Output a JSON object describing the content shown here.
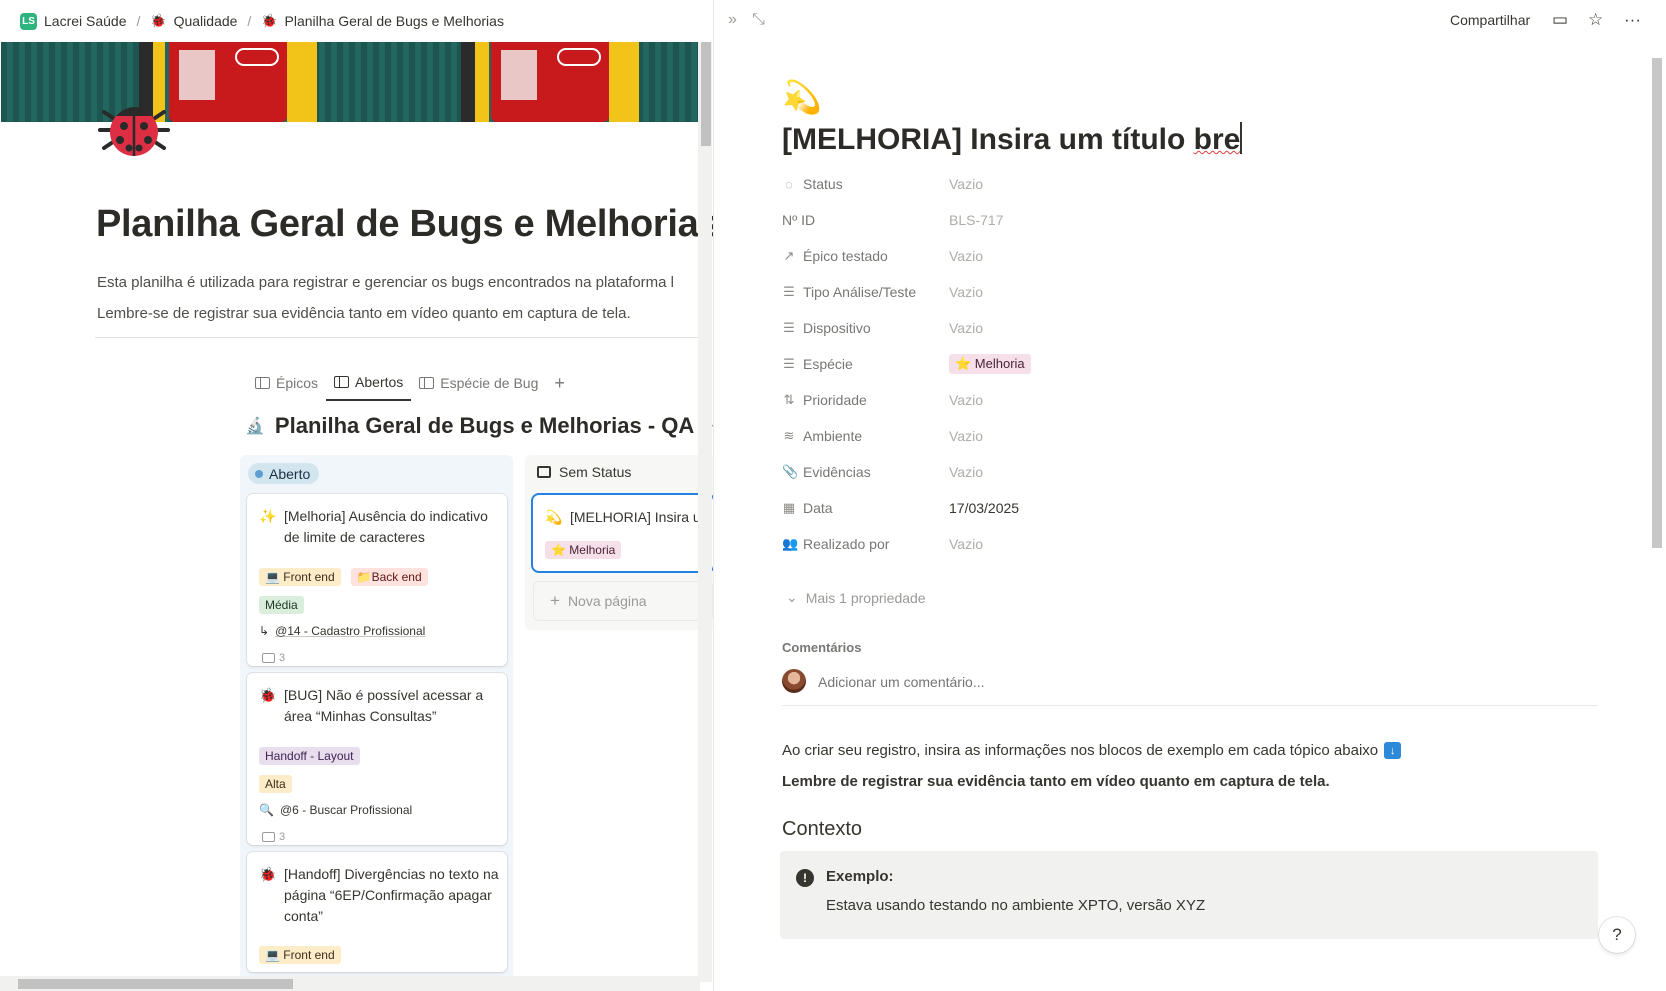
{
  "breadcrumb": [
    {
      "label": "Lacrei Saúde",
      "icon": "workspace-logo"
    },
    {
      "label": "Qualidade",
      "icon": "ladybug-icon"
    },
    {
      "label": "Planilha Geral de Bugs e Melhorias",
      "icon": "ladybug-icon"
    }
  ],
  "workspace_logo_text": "LS",
  "page": {
    "title": "Planilha Geral de Bugs e Melhorias",
    "description": [
      "Esta planilha é utilizada para registrar e gerenciar os bugs encontrados na plataforma l",
      "Lembre-se de registrar sua evidência tanto em vídeo quanto em captura de tela."
    ]
  },
  "tabs": [
    {
      "label": "Épicos",
      "active": false,
      "icon": "table-icon"
    },
    {
      "label": "Abertos",
      "active": true,
      "icon": "board-icon"
    },
    {
      "label": "Espécie de Bug",
      "active": false,
      "icon": "board-icon"
    }
  ],
  "add_tab": "+",
  "database_title": "Planilha Geral de Bugs e Melhorias - QA",
  "board": {
    "open_group": "Aberto",
    "open_cards": [
      {
        "icon": "✨",
        "title": "[Melhoria] Ausência do indicativo de limite de caracteres",
        "tags": [
          {
            "label": "💻 Front end",
            "color": "yellow"
          },
          {
            "label": "📁Back end",
            "color": "red"
          }
        ],
        "priority": "Média",
        "epic": "@14 - Cadastro Profissional",
        "epic_icon": "↳",
        "comments": "3"
      },
      {
        "icon": "🐞",
        "title": "[BUG] Não é possível acessar a área “Minhas Consultas”",
        "tags": [
          {
            "label": "Handoff - Layout",
            "color": "purple"
          }
        ],
        "priority": "Alta",
        "epic": "@6 - Buscar Profissional",
        "epic_icon": "🔍",
        "comments": "3"
      },
      {
        "icon": "🐞",
        "title": "[Handoff] Divergências no texto na página “6EP/Confirmação apagar conta”",
        "tags": [
          {
            "label": "💻 Front end",
            "color": "yellow"
          }
        ]
      }
    ],
    "nostatus_group": "Sem Status",
    "nostatus_card": {
      "icon": "💫",
      "title": "[MELHORIA] Insira u",
      "tag": "⭐ Melhoria"
    },
    "new_page": "Nova página"
  },
  "peek": {
    "share": "Compartilhar",
    "title_main": "[MELHORIA] Insira um título ",
    "title_spell": "bre",
    "properties": [
      {
        "name": "Status",
        "value": "Vazio",
        "icon": "◌"
      },
      {
        "name": "Nº ID",
        "value": "BLS-717",
        "icon": ""
      },
      {
        "name": "Épico testado",
        "value": "Vazio",
        "icon": "↗"
      },
      {
        "name": "Tipo Análise/Teste",
        "value": "Vazio",
        "icon": "☰"
      },
      {
        "name": "Dispositivo",
        "value": "Vazio",
        "icon": "☰"
      },
      {
        "name": "Espécie",
        "value": "⭐ Melhoria",
        "icon": "☰",
        "tag": true
      },
      {
        "name": "Prioridade",
        "value": "Vazio",
        "icon": "⇅"
      },
      {
        "name": "Ambiente",
        "value": "Vazio",
        "icon": "≋"
      },
      {
        "name": "Evidências",
        "value": "Vazio",
        "icon": "📎"
      },
      {
        "name": "Data",
        "value": "17/03/2025",
        "icon": "▦",
        "dark": true
      },
      {
        "name": "Realizado por",
        "value": "Vazio",
        "icon": "👥"
      }
    ],
    "more_props": "Mais 1 propriedade",
    "comments_label": "Comentários",
    "comment_placeholder": "Adicionar um comentário...",
    "body_line1": "Ao criar seu registro, insira as informações nos blocos de exemplo em cada tópico abaixo",
    "body_line2": "Lembre de registrar sua evidência tanto em vídeo quanto em captura de tela.",
    "heading": "Contexto",
    "callout_title": "Exemplo:",
    "callout_text": "Estava usando testando no ambiente XPTO, versão XYZ"
  },
  "help": "?"
}
